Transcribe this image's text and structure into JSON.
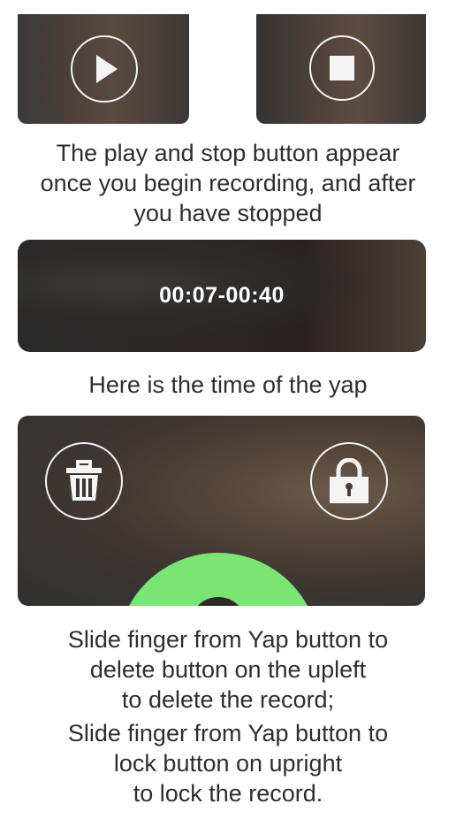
{
  "icons": {
    "play": "play-icon",
    "stop": "stop-icon",
    "trash": "trash-icon",
    "lock": "lock-icon"
  },
  "colors": {
    "yap_button": "#7be574",
    "icon_stroke": "#f4f4f4"
  },
  "captions": {
    "play_stop": "The play and stop button appear\nonce you begin recording, and after\nyou have stopped",
    "time": "Here is the time of the yap",
    "delete": "Slide finger from Yap button to\ndelete button on the upleft\nto delete the record;",
    "lock": "Slide finger from Yap button to\nlock button on upright\nto lock the record."
  },
  "time_panel": {
    "time_range": "00:07-00:40"
  }
}
